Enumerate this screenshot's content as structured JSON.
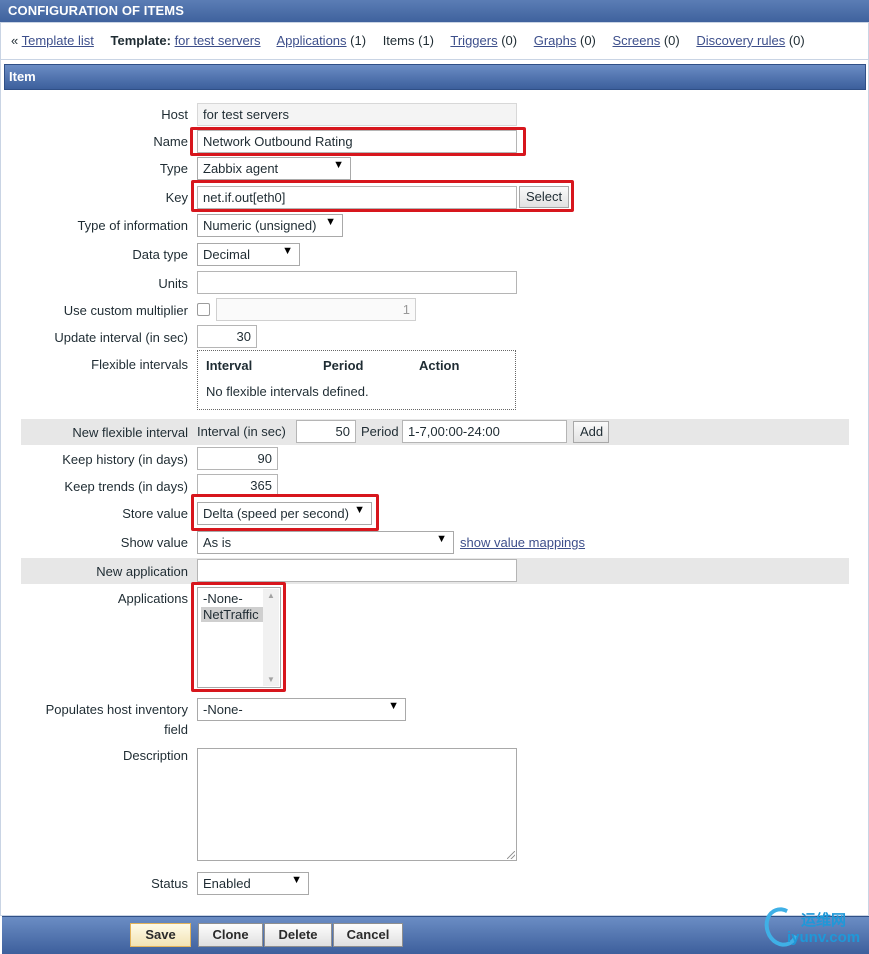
{
  "header": {
    "title": "CONFIGURATION OF ITEMS"
  },
  "nav": {
    "back_symbol": "«",
    "template_list": "Template list",
    "template_label": "Template:",
    "template_name": "for test servers",
    "applications": "Applications",
    "applications_count": "(1)",
    "items": "Items",
    "items_count": "(1)",
    "triggers": "Triggers",
    "triggers_count": "(0)",
    "graphs": "Graphs",
    "graphs_count": "(0)",
    "screens": "Screens",
    "screens_count": "(0)",
    "discovery_rules": "Discovery rules",
    "discovery_rules_count": "(0)"
  },
  "section": {
    "title": "Item"
  },
  "form": {
    "host": {
      "label": "Host",
      "value": "for test servers"
    },
    "name": {
      "label": "Name",
      "value": "Network Outbound Rating"
    },
    "type": {
      "label": "Type",
      "value": "Zabbix agent"
    },
    "key": {
      "label": "Key",
      "value": "net.if.out[eth0]",
      "button": "Select"
    },
    "type_of_information": {
      "label": "Type of information",
      "value": "Numeric (unsigned)"
    },
    "data_type": {
      "label": "Data type",
      "value": "Decimal"
    },
    "units": {
      "label": "Units",
      "value": ""
    },
    "custom_multiplier": {
      "label": "Use custom multiplier",
      "checked": false,
      "value": "1"
    },
    "update_interval": {
      "label": "Update interval (in sec)",
      "value": "30"
    },
    "flexible_intervals": {
      "label": "Flexible intervals",
      "columns": [
        "Interval",
        "Period",
        "Action"
      ],
      "empty_text": "No flexible intervals defined."
    },
    "new_flexible_interval": {
      "label": "New flexible interval",
      "interval_label": "Interval (in sec)",
      "interval_value": "50",
      "period_label": "Period",
      "period_value": "1-7,00:00-24:00",
      "add_button": "Add"
    },
    "keep_history": {
      "label": "Keep history (in days)",
      "value": "90"
    },
    "keep_trends": {
      "label": "Keep trends (in days)",
      "value": "365"
    },
    "store_value": {
      "label": "Store value",
      "value": "Delta (speed per second)"
    },
    "show_value": {
      "label": "Show value",
      "value": "As is",
      "link": "show value mappings"
    },
    "new_application": {
      "label": "New application",
      "value": ""
    },
    "applications": {
      "label": "Applications",
      "options": [
        "-None-",
        "NetTraffic"
      ],
      "selected": "NetTraffic"
    },
    "inventory": {
      "label_line1": "Populates host inventory",
      "label_line2": "field",
      "value": "-None-"
    },
    "description": {
      "label": "Description",
      "value": ""
    },
    "status": {
      "label": "Status",
      "value": "Enabled"
    }
  },
  "footer": {
    "save": "Save",
    "clone": "Clone",
    "delete": "Delete",
    "cancel": "Cancel"
  },
  "watermark": {
    "line1": "运维网",
    "line2": "iyunv.com"
  },
  "colors": {
    "header_blue": "#3f629d",
    "highlight_red": "#d7161d",
    "link": "#3d4f8b"
  }
}
